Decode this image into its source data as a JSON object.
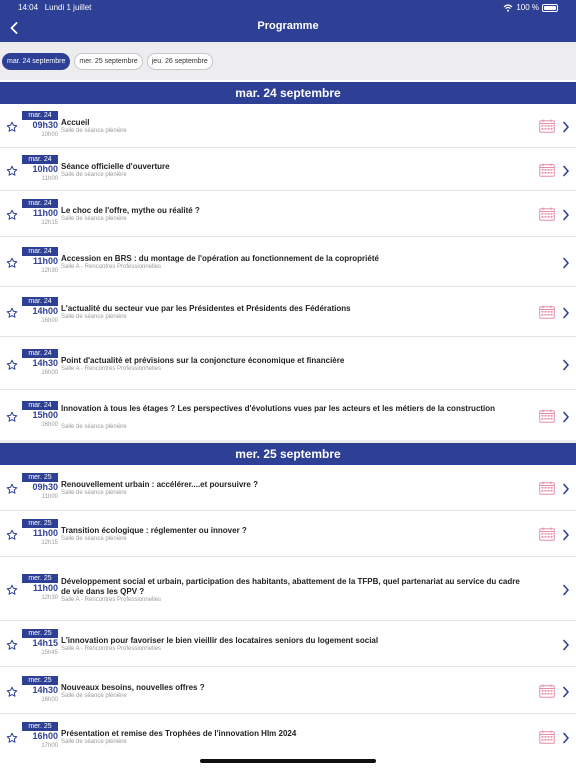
{
  "status": {
    "time": "14:04",
    "date": "Lundi 1 juillet",
    "battery": "100 %"
  },
  "nav": {
    "title": "Programme"
  },
  "tabs": [
    {
      "label": "mar. 24 septembre",
      "active": true
    },
    {
      "label": "mer. 25 septembre",
      "active": false
    },
    {
      "label": "jeu. 26 septembre",
      "active": false
    }
  ],
  "colors": {
    "primary": "#2e3f96",
    "calendar_icon": "#e48ea6"
  },
  "days": [
    {
      "header": "mar. 24 septembre",
      "sessions": [
        {
          "date": "mar. 24",
          "start": "09h30",
          "end": "10h00",
          "title": "Accueil",
          "room": "Salle de séance plénière",
          "calendar": true
        },
        {
          "date": "mar. 24",
          "start": "10h00",
          "end": "11h00",
          "title": "Séance officielle d'ouverture",
          "room": "Salle de séance plénière",
          "calendar": true
        },
        {
          "date": "mar. 24",
          "start": "11h00",
          "end": "12h15",
          "title": "Le choc de l'offre, mythe ou réalité ?",
          "room": "Salle de séance plénière",
          "calendar": true
        },
        {
          "date": "mar. 24",
          "start": "11h00",
          "end": "12h30",
          "title": "Accession en BRS : du montage de l'opération au fonctionnement de la copropriété",
          "room": "Salle A - Rencontres Professionnelles",
          "calendar": false
        },
        {
          "date": "mar. 24",
          "start": "14h00",
          "end": "16h00",
          "title": "L'actualité du secteur vue par les Présidentes et Présidents des Fédérations",
          "room": "Salle de séance plénière",
          "calendar": true
        },
        {
          "date": "mar. 24",
          "start": "14h30",
          "end": "16h00",
          "title": "Point d'actualité et prévisions sur la conjoncture économique et financière",
          "room": "Salle A - Rencontres Professionnelles",
          "calendar": false
        },
        {
          "date": "mar. 24",
          "start": "15h00",
          "end": "16h00",
          "title": "Innovation à tous les étages ? Les perspectives d'évolutions vues par les acteurs et les métiers de la construction",
          "room": "Salle de séance plénière",
          "calendar": true
        }
      ]
    },
    {
      "header": "mer. 25 septembre",
      "sessions": [
        {
          "date": "mer. 25",
          "start": "09h30",
          "end": "11h00",
          "title": "Renouvellement urbain : accélérer....et poursuivre ?",
          "room": "Salle de séance plénière",
          "calendar": true
        },
        {
          "date": "mer. 25",
          "start": "11h00",
          "end": "12h15",
          "title": "Transition écologique : réglementer ou innover ?",
          "room": "Salle de séance plénière",
          "calendar": true
        },
        {
          "date": "mer. 25",
          "start": "11h00",
          "end": "12h30",
          "title": "Développement social et urbain, participation des habitants, abattement de la TFPB, quel partenariat au service du cadre de vie dans les QPV ?",
          "room": "Salle A - Rencontres Professionnelles",
          "calendar": false
        },
        {
          "date": "mer. 25",
          "start": "14h15",
          "end": "15h45",
          "title": "L'innovation pour favoriser le bien vieillir des locataires seniors du logement social",
          "room": "Salle A - Rencontres Professionnelles",
          "calendar": false
        },
        {
          "date": "mer. 25",
          "start": "14h30",
          "end": "16h00",
          "title": "Nouveaux besoins, nouvelles offres ?",
          "room": "Salle de séance plénière",
          "calendar": true
        },
        {
          "date": "mer. 25",
          "start": "16h00",
          "end": "17h00",
          "title": "Présentation et remise des Trophées de l'innovation Hlm 2024",
          "room": "Salle de séance plénière",
          "calendar": true
        }
      ]
    }
  ]
}
